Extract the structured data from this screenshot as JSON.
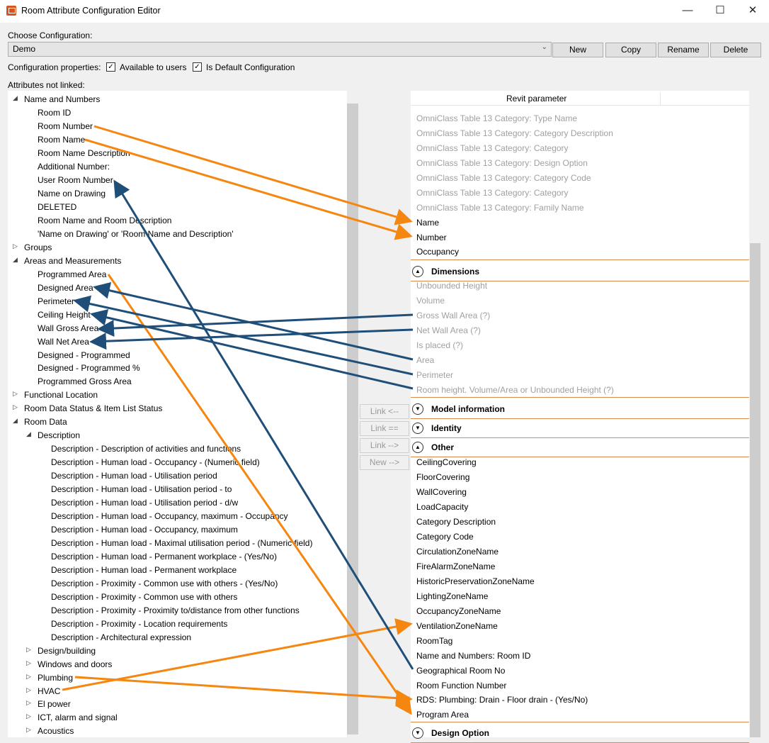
{
  "window": {
    "title": "Room Attribute Configuration Editor",
    "minimize_glyph": "—",
    "maximize_glyph": "☐",
    "close_glyph": "✕"
  },
  "config": {
    "choose_label": "Choose Configuration:",
    "selected": "Demo",
    "buttons": {
      "new": "New",
      "copy": "Copy",
      "rename": "Rename",
      "delete": "Delete"
    },
    "props_label": "Configuration properties:",
    "available": "Available to users",
    "is_default": "Is Default Configuration",
    "not_linked_label": "Attributes not linked:"
  },
  "tree": [
    "Name and Numbers",
    "Room ID",
    "Room Number",
    "Room Name",
    "Room Name Description",
    "Additional Number:",
    "User Room Number",
    "Name on Drawing",
    "DELETED",
    "Room Name and Room Description",
    "'Name on Drawing' or 'Room Name and Description'",
    "Groups",
    "Areas and Measurements",
    "Programmed Area",
    "Designed Area",
    "Perimeter",
    "Ceiling Height",
    "Wall Gross Area",
    "Wall Net Area",
    "Designed - Programmed",
    "Designed - Programmed %",
    "Programmed Gross Area",
    "Functional Location",
    "Room Data Status & Item List Status",
    "Room Data",
    "Description",
    "Description - Description of activities and functions",
    "Description - Human load - Occupancy - (Numeric field)",
    "Description - Human load - Utilisation period",
    "Description - Human load - Utilisation period - to",
    "Description - Human load - Utilisation period - d/w",
    "Description - Human load - Occupancy, maximum - Occupancy",
    "Description - Human load - Occupancy, maximum",
    "Description - Human load - Maximal utilisation period - (Numeric field)",
    "Description - Human load - Permanent workplace - (Yes/No)",
    "Description - Human load - Permanent workplace",
    "Description - Proximity - Common use with others - (Yes/No)",
    "Description - Proximity - Common use with others",
    "Description - Proximity - Proximity to/distance from other functions",
    "Description - Proximity - Location requirements",
    "Description - Architectural  expression",
    "Design/building",
    "Windows and doors",
    "Plumbing",
    "HVAC",
    "El power",
    "ICT, alarm and signal",
    "Acoustics"
  ],
  "right": {
    "header": "Revit parameter",
    "top_items": [
      "OmniClass Table 13 Category: Type Name",
      "OmniClass Table 13 Category: Category Description",
      "OmniClass Table 13 Category: Category",
      "OmniClass Table 13 Category: Design Option",
      "OmniClass Table 13 Category: Category Code",
      "OmniClass Table 13 Category: Category",
      "OmniClass Table 13 Category: Family Name",
      "Name",
      "Number",
      "Occupancy"
    ],
    "groups": [
      "Dimensions",
      "Model information",
      "Identity",
      "Other",
      "Design Option"
    ],
    "dimension_items": [
      "Unbounded Height",
      "Volume",
      "Gross Wall Area (?)",
      "Net Wall Area (?)",
      "Is placed (?)",
      "Area",
      "Perimeter",
      "Room height. Volume/Area or Unbounded Height (?)"
    ],
    "other_items": [
      "CeilingCovering",
      "FloorCovering",
      "WallCovering",
      "LoadCapacity",
      "Category Description",
      "Category Code",
      "CirculationZoneName",
      "FireAlarmZoneName",
      "HistoricPreservationZoneName",
      "LightingZoneName",
      "OccupancyZoneName",
      "VentilationZoneName",
      "RoomTag",
      "Name and Numbers: Room ID",
      "Geographical Room No",
      "Room Function Number",
      "RDS: Plumbing: Drain - Floor drain - (Yes/No)",
      "Program Area"
    ]
  },
  "link_buttons": {
    "link_left": "Link <--",
    "link_eq": "Link ==",
    "link_right": "Link -->",
    "new_right": "New -->"
  },
  "colors": {
    "orange_arrow": "#f5860f",
    "blue_arrow": "#1f4e79",
    "group_line": "#d98a4f",
    "dim_text": "#a0a0a0"
  }
}
